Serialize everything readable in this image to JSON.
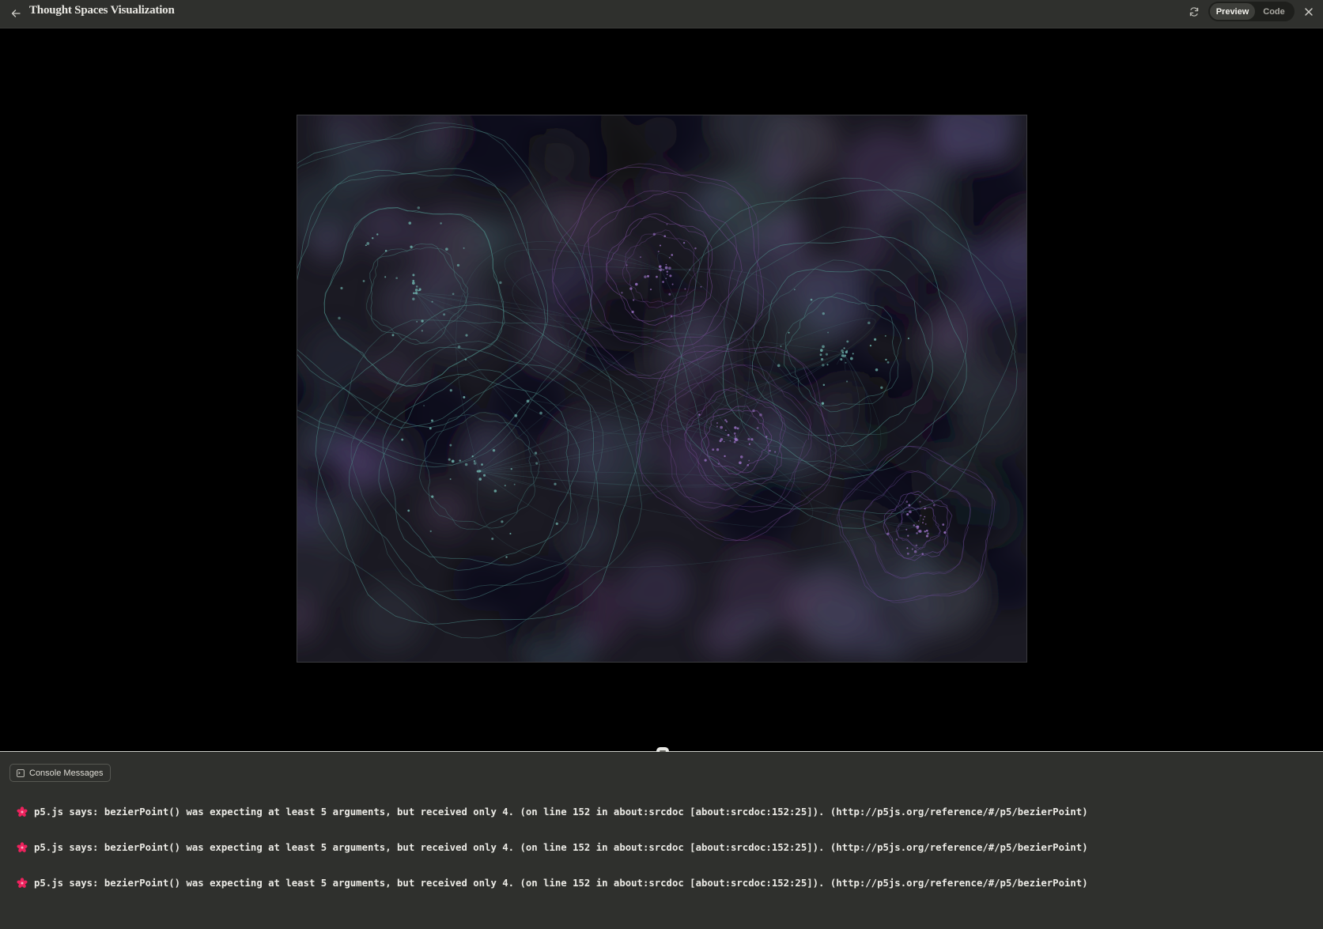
{
  "header": {
    "title": "Thought Spaces Visualization",
    "back_icon": "arrow-left-icon",
    "refresh_icon": "refresh-icon",
    "close_icon": "close-icon",
    "tabs": [
      {
        "label": "Preview",
        "active": true
      },
      {
        "label": "Code",
        "active": false
      }
    ]
  },
  "console": {
    "button_label": "Console Messages",
    "messages": [
      {
        "icon": "p5-flower-icon",
        "text": "p5.js says: bezierPoint() was expecting at least 5 arguments, but received only 4. (on line 152 in about:srcdoc [about:srcdoc:152:25]). (http://p5js.org/reference/#/p5/bezierPoint)"
      },
      {
        "icon": "p5-flower-icon",
        "text": "p5.js says: bezierPoint() was expecting at least 5 arguments, but received only 4. (on line 152 in about:srcdoc [about:srcdoc:152:25]). (http://p5js.org/reference/#/p5/bezierPoint)"
      },
      {
        "icon": "p5-flower-icon",
        "text": "p5.js says: bezierPoint() was expecting at least 5 arguments, but received only 4. (on line 152 in about:srcdoc [about:srcdoc:152:25]). (http://p5js.org/reference/#/p5/bezierPoint)"
      }
    ]
  },
  "colors": {
    "topbar_bg": "#2f302d",
    "console_bg": "#2f302d",
    "canvas_bg": "#1a1922",
    "teal_ring": "#4f8f8a",
    "purple_ring": "#7a4d9a",
    "p5_pink": "#ed225d"
  }
}
